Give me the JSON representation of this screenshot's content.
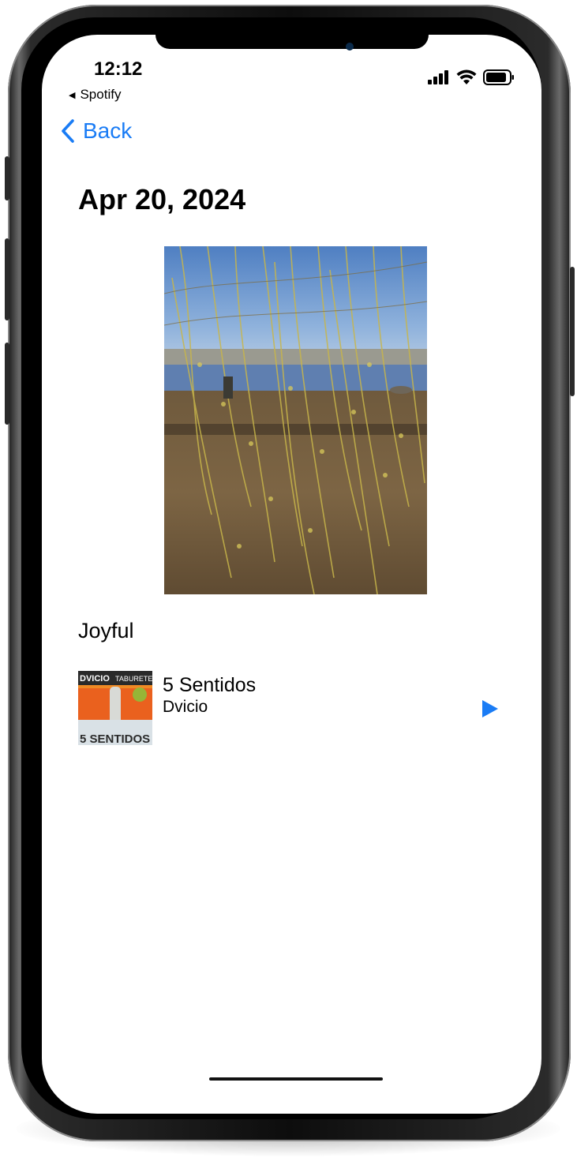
{
  "status_bar": {
    "time": "12:12",
    "back_app": "Spotify"
  },
  "nav": {
    "back_label": "Back"
  },
  "entry": {
    "date": "Apr 20, 2024",
    "mood": "Joyful"
  },
  "track": {
    "title": "5 Sentidos",
    "artist": "Dvicio",
    "art_text_top_left": "DVICIO",
    "art_text_top_right": "TABURETE",
    "art_text_bottom": "5 SENTIDOS"
  },
  "colors": {
    "accent": "#1a7cf5",
    "text": "#000000",
    "background": "#ffffff"
  },
  "icons": {
    "back": "chevron-left-icon",
    "play": "play-icon",
    "signal": "cellular-signal-icon",
    "wifi": "wifi-icon",
    "battery": "battery-icon"
  }
}
